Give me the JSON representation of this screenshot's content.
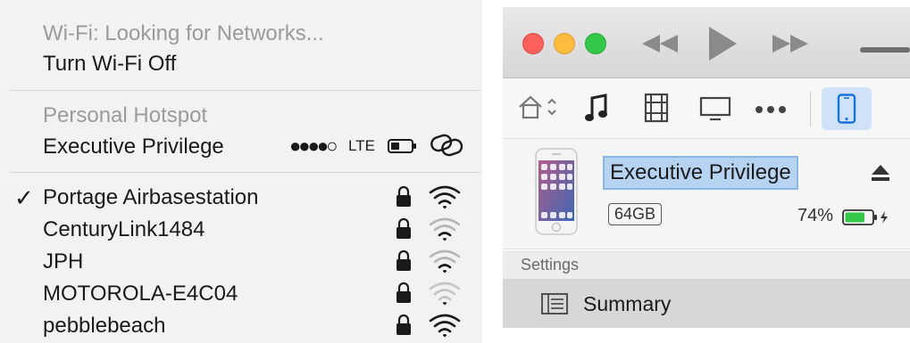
{
  "wifi_menu": {
    "status_text": "Wi-Fi: Looking for Networks...",
    "toggle_label": "Turn Wi-Fi Off",
    "hotspot_header": "Personal Hotspot",
    "hotspot": {
      "name": "Executive Privilege",
      "signal_dots": "●●●●○",
      "network_type": "LTE",
      "icon": "link-icon"
    },
    "networks": [
      {
        "name": "Portage Airbasestation",
        "selected": true,
        "secured": true,
        "signal": "full"
      },
      {
        "name": "CenturyLink1484",
        "selected": false,
        "secured": true,
        "signal": "weak"
      },
      {
        "name": "JPH",
        "selected": false,
        "secured": true,
        "signal": "weak"
      },
      {
        "name": "MOTOROLA-E4C04",
        "selected": false,
        "secured": true,
        "signal": "very-weak"
      },
      {
        "name": "pebblebeach",
        "selected": false,
        "secured": true,
        "signal": "full"
      }
    ],
    "check_mark": "✓"
  },
  "itunes": {
    "window_controls": [
      "close",
      "minimize",
      "zoom"
    ],
    "transport": [
      "rewind-icon",
      "play-icon",
      "fast-forward-icon"
    ],
    "media_tabs": [
      "home-icon",
      "music-icon",
      "movies-icon",
      "tv-icon",
      "more-icon",
      "iphone-icon"
    ],
    "device": {
      "name": "Executive Privilege",
      "capacity": "64GB",
      "battery_percent": "74%",
      "battery_level": 0.74,
      "battery_color": "#34c748"
    },
    "sidebar": {
      "section_label": "Settings",
      "items": [
        {
          "label": "Summary",
          "icon": "list-icon",
          "selected": true
        }
      ]
    }
  }
}
